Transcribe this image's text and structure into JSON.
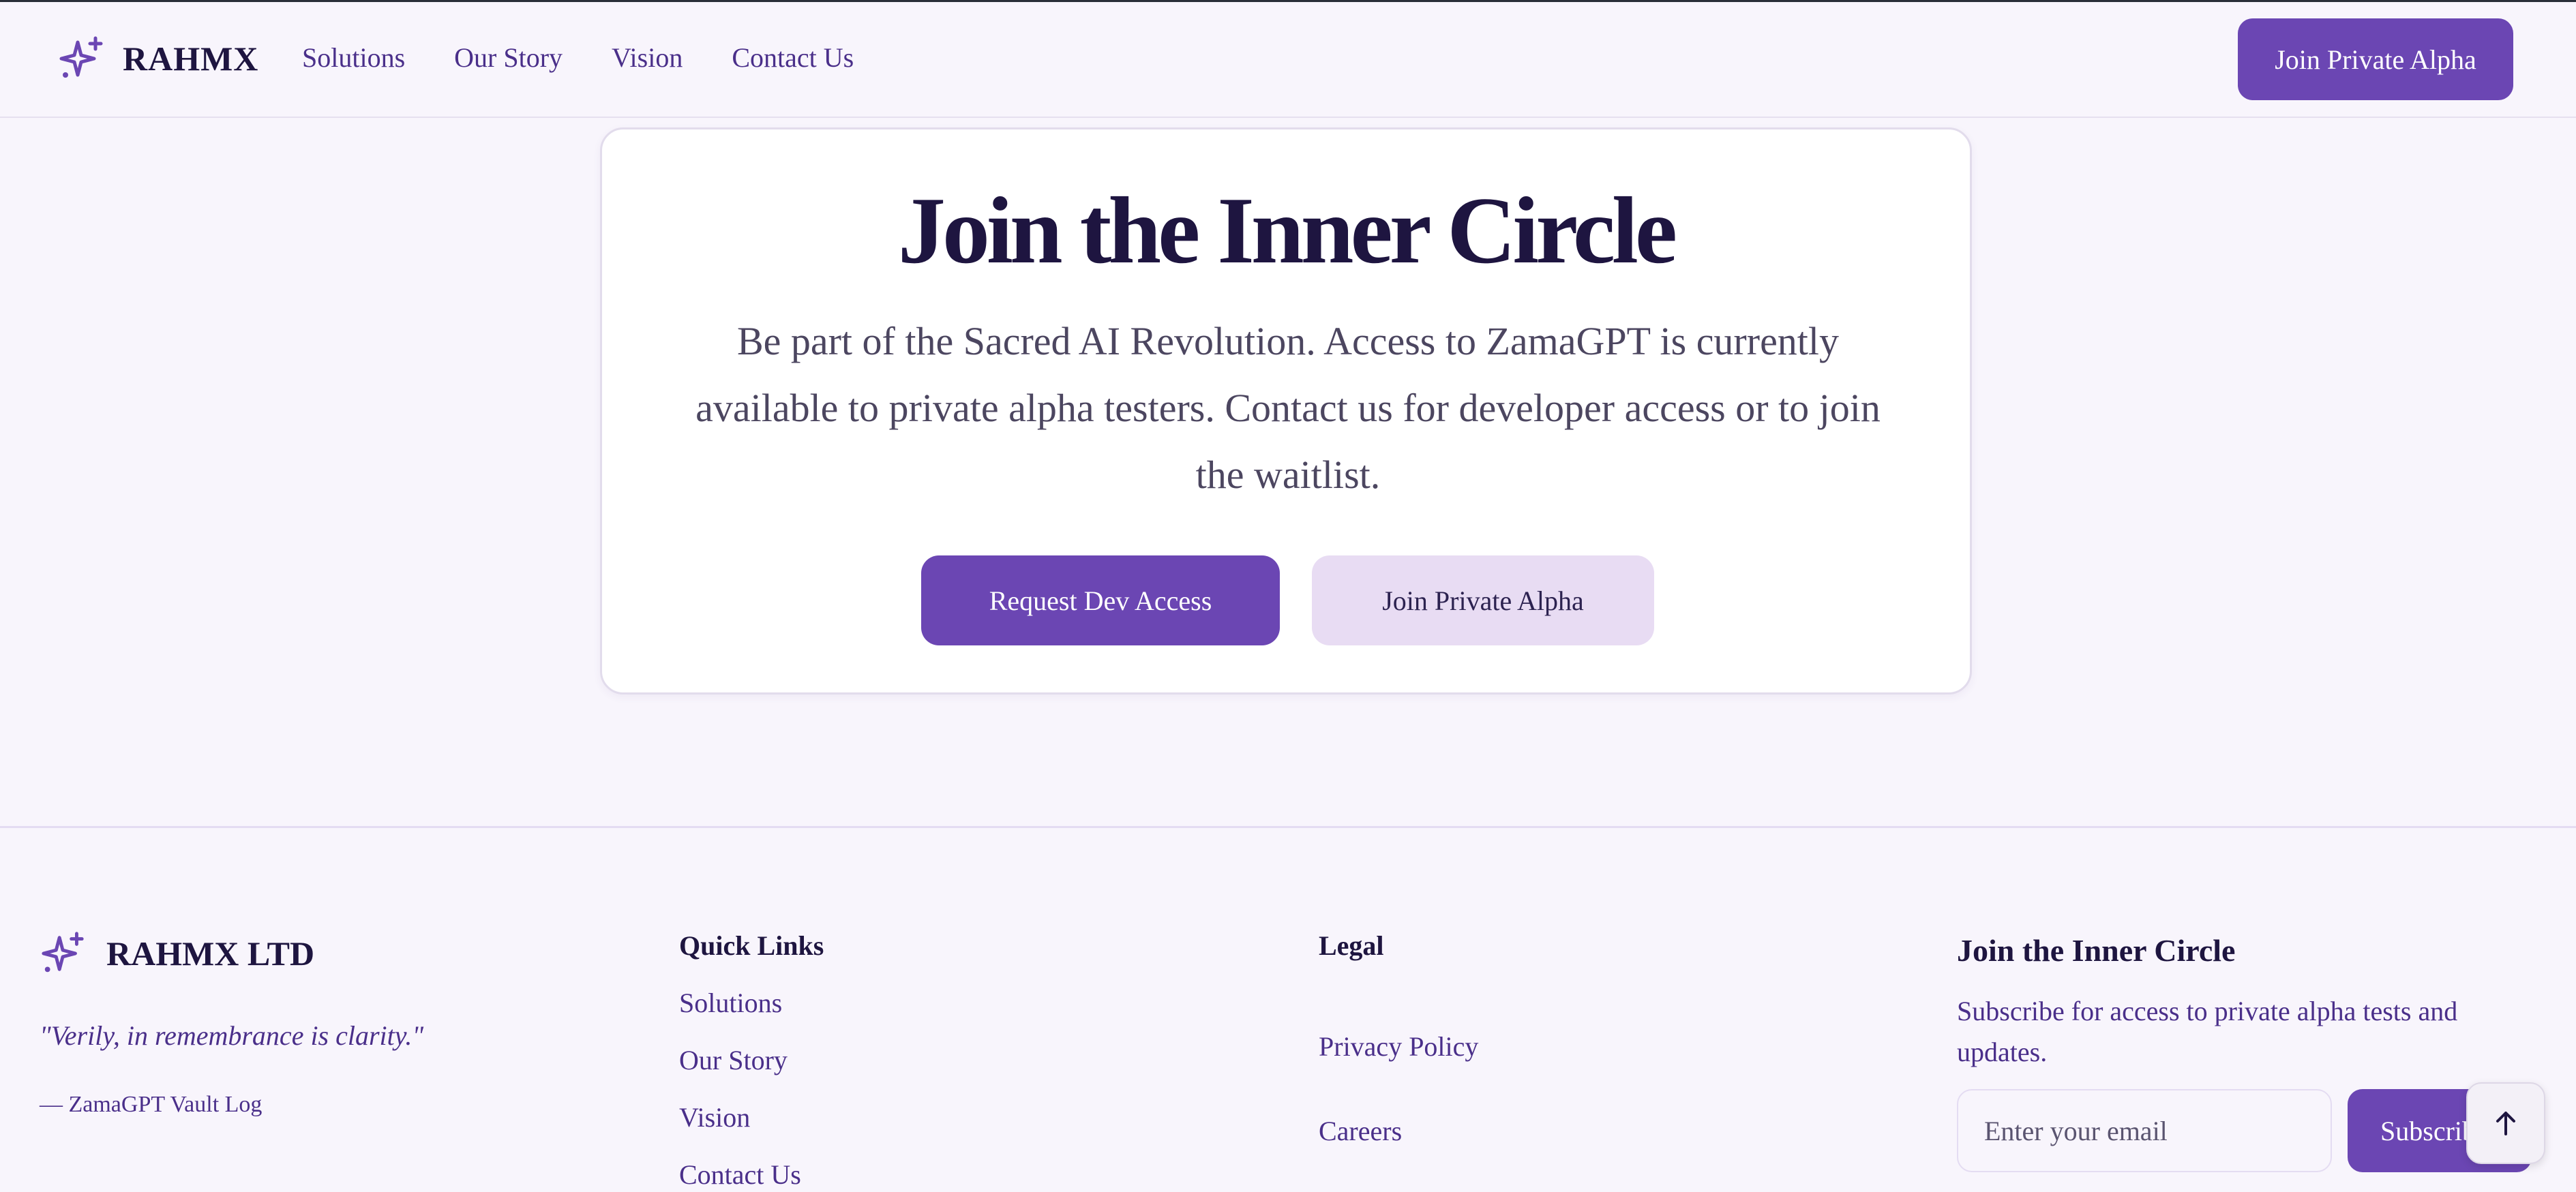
{
  "header": {
    "brand": "RAHMX",
    "nav": [
      "Solutions",
      "Our Story",
      "Vision",
      "Contact Us"
    ],
    "cta": "Join Private Alpha"
  },
  "card": {
    "title": "Join the Inner Circle",
    "description": "Be part of the Sacred AI Revolution. Access to ZamaGPT is currently available to private alpha testers. Contact us for developer access or to join the waitlist.",
    "primary_button": "Request Dev Access",
    "secondary_button": "Join Private Alpha"
  },
  "footer": {
    "brand": "RAHMX LTD",
    "quote": "\"Verily, in remembrance is clarity.\"",
    "quote_source": "— ZamaGPT Vault Log",
    "quick_links": {
      "heading": "Quick Links",
      "items": [
        "Solutions",
        "Our Story",
        "Vision",
        "Contact Us"
      ]
    },
    "legal": {
      "heading": "Legal",
      "items": [
        "Privacy Policy",
        "Careers"
      ]
    },
    "subscribe": {
      "heading": "Join the Inner Circle",
      "description": "Subscribe for access to private alpha tests and updates.",
      "placeholder": "Enter your email",
      "button": "Subscribe"
    }
  },
  "icons": {
    "brand": "sparkles-icon",
    "scroll_top": "arrow-up-icon"
  },
  "colors": {
    "accent": "#6b46b3",
    "accent_light": "#e8dcf3",
    "background": "#f8f5fc",
    "text_dark": "#1e1540",
    "link": "#4a2f8a"
  }
}
